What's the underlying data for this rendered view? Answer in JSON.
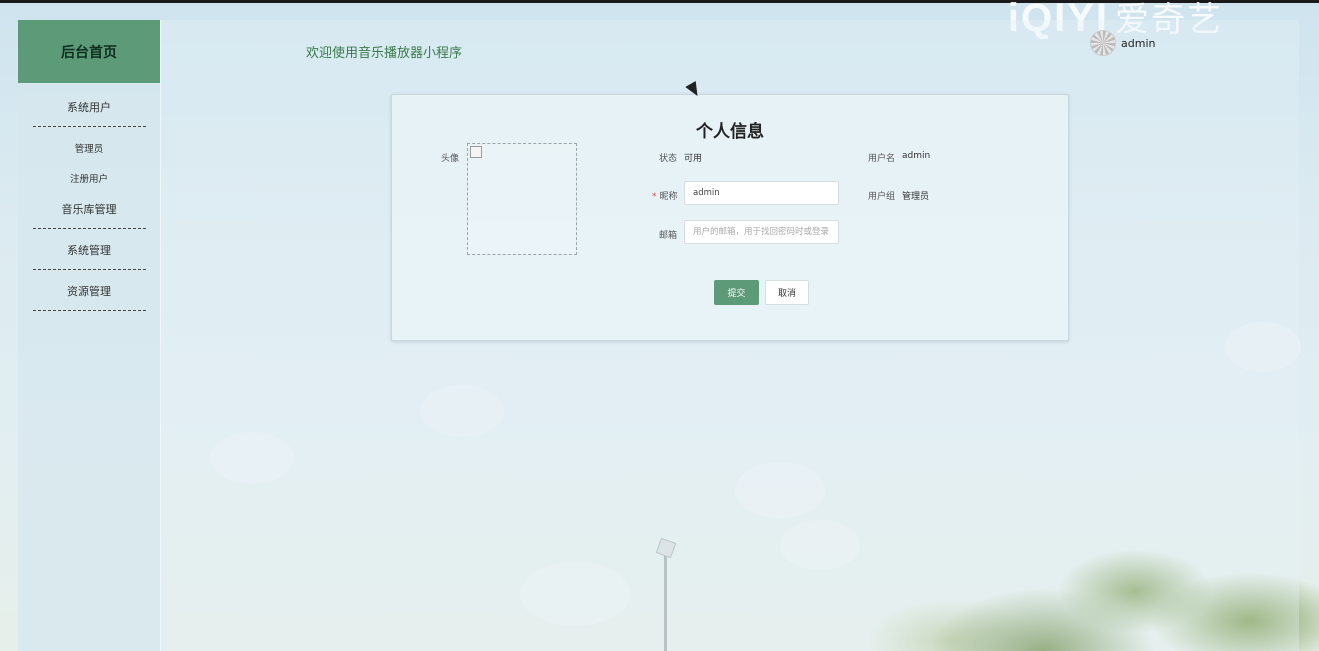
{
  "watermark": {
    "latin": "iQIYI",
    "cn": "爱奇艺"
  },
  "sidebar": {
    "home": "后台首页",
    "groups": [
      {
        "label": "系统用户",
        "items": [
          "管理员",
          "注册用户"
        ]
      },
      {
        "label": "音乐库管理",
        "items": []
      },
      {
        "label": "系统管理",
        "items": []
      },
      {
        "label": "资源管理",
        "items": []
      }
    ]
  },
  "header": {
    "welcome": "欢迎使用音乐播放器小程序",
    "user": "admin"
  },
  "profile": {
    "title": "个人信息",
    "avatar_label": "头像",
    "status_label": "状态",
    "status_value": "可用",
    "username_label": "用户名",
    "username_value": "admin",
    "nickname_label": "昵称",
    "nickname_value": "admin",
    "usergroup_label": "用户组",
    "usergroup_value": "管理员",
    "email_label": "邮箱",
    "email_placeholder": "用户的邮箱，用于找回密码时或登录",
    "submit": "提交",
    "cancel": "取消"
  },
  "colors": {
    "accent": "#5c9a78",
    "welcome_text": "#3a7a4a",
    "required_mark": "#e04a4a"
  }
}
